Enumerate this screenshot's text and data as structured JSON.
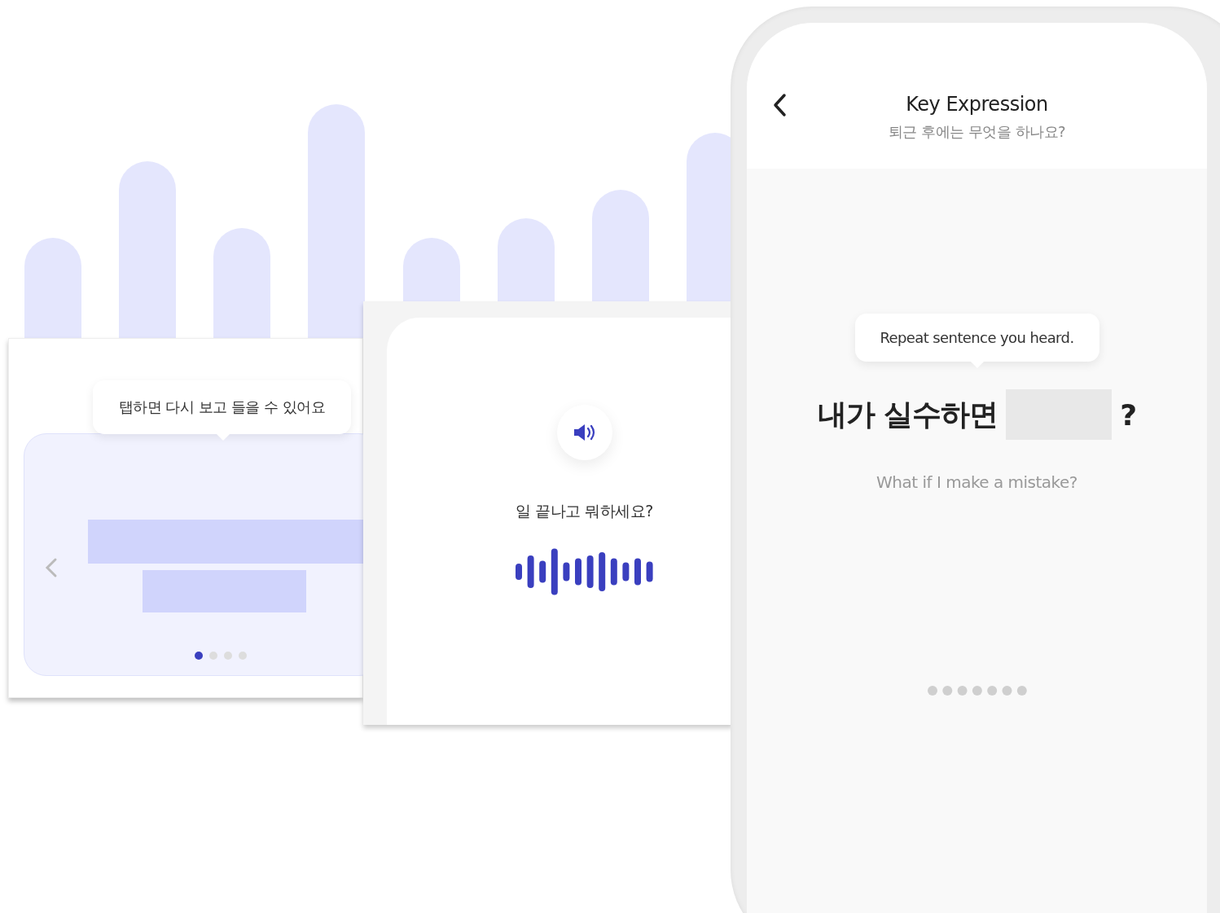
{
  "tap_card": {
    "tooltip": "탭하면 다시 보고 들을 수 있어요",
    "pages": [
      {
        "selected": true
      },
      {
        "selected": false
      },
      {
        "selected": false
      },
      {
        "selected": false
      }
    ]
  },
  "listen_card": {
    "phrase": "일 끝나고 뭐하세요?"
  },
  "phone": {
    "title": "Key Expression",
    "subtitle": "퇴근 후에는 무엇을 하나요?",
    "tooltip": "Repeat sentence you heard.",
    "sentence": {
      "before": "내가 실수하면",
      "after": "?"
    },
    "translation": "What if I make a mistake?"
  }
}
